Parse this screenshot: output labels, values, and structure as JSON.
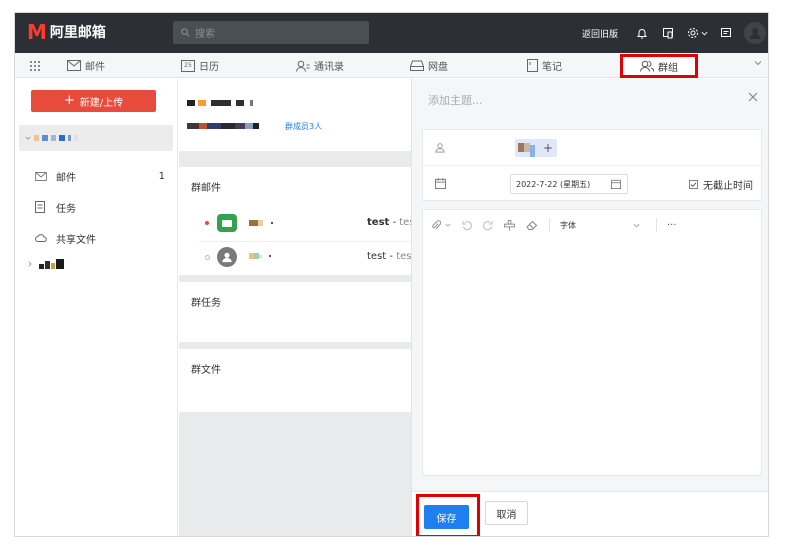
{
  "app": {
    "logo_text": "阿里邮箱",
    "brand_color": "#ff3b30"
  },
  "search": {
    "placeholder": "搜索"
  },
  "topbar": {
    "back_old": "返回旧版"
  },
  "nav": {
    "mail": "邮件",
    "calendar": "日历",
    "calendar_day": "25",
    "contacts": "通讯录",
    "disk": "网盘",
    "notes": "笔记",
    "groups": "群组"
  },
  "sidebar": {
    "new_button": "新建/上传",
    "items": [
      {
        "label": "邮件",
        "count": "1"
      },
      {
        "label": "任务"
      },
      {
        "label": "共享文件"
      }
    ]
  },
  "middle": {
    "member_count": "群成员3人",
    "sections": {
      "mail": "群邮件",
      "tasks": "群任务",
      "files": "群文件"
    },
    "mails": [
      {
        "subject": "test",
        "preview": "test"
      },
      {
        "subject": "test",
        "preview": "test"
      }
    ]
  },
  "editor": {
    "title_placeholder": "添加主题...",
    "date": "2022-7-22 (星期五)",
    "no_deadline": "无截止时间",
    "font": "字体",
    "more": "···"
  },
  "footer": {
    "save": "保存",
    "cancel": "取消"
  },
  "colors": {
    "topbar": "#2c3036",
    "primary": "#1e7ff0",
    "new_button": "#e84a3b",
    "highlight": "#e00000"
  }
}
